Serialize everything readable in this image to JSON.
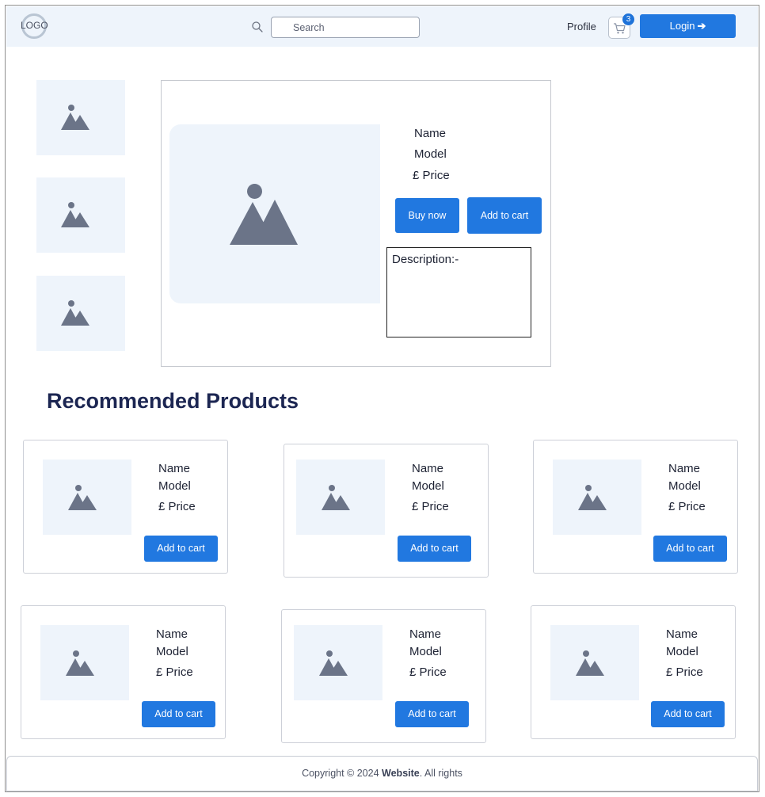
{
  "header": {
    "logo_text": "LOGO",
    "search_placeholder": "Search",
    "profile_label": "Profile",
    "cart_count": "3",
    "login_label": "Login"
  },
  "product": {
    "name": "Name",
    "model": "Model",
    "price": "£ Price",
    "buy_now_label": "Buy now",
    "add_to_cart_label": "Add to cart",
    "description_label": "Description:-"
  },
  "recommended": {
    "title": "Recommended Products",
    "items": [
      {
        "name": "Name",
        "model": "Model",
        "price": "£ Price",
        "button": "Add to cart"
      },
      {
        "name": "Name",
        "model": "Model",
        "price": "£ Price",
        "button": "Add to cart"
      },
      {
        "name": "Name",
        "model": "Model",
        "price": "£ Price",
        "button": "Add to cart"
      },
      {
        "name": "Name",
        "model": "Model",
        "price": "£ Price",
        "button": "Add to cart"
      },
      {
        "name": "Name",
        "model": "Model",
        "price": "£ Price",
        "button": "Add to cart"
      },
      {
        "name": "Name",
        "model": "Model",
        "price": "£ Price",
        "button": "Add to cart"
      }
    ]
  },
  "footer": {
    "copyright_prefix": "Copyright © 2024",
    "site_name": "Website",
    "copyright_suffix": ". All rights"
  },
  "colors": {
    "accent": "#2178e0",
    "header_bg": "#eef4fb",
    "placeholder_bg": "#eef4fb",
    "title": "#1c2652"
  }
}
